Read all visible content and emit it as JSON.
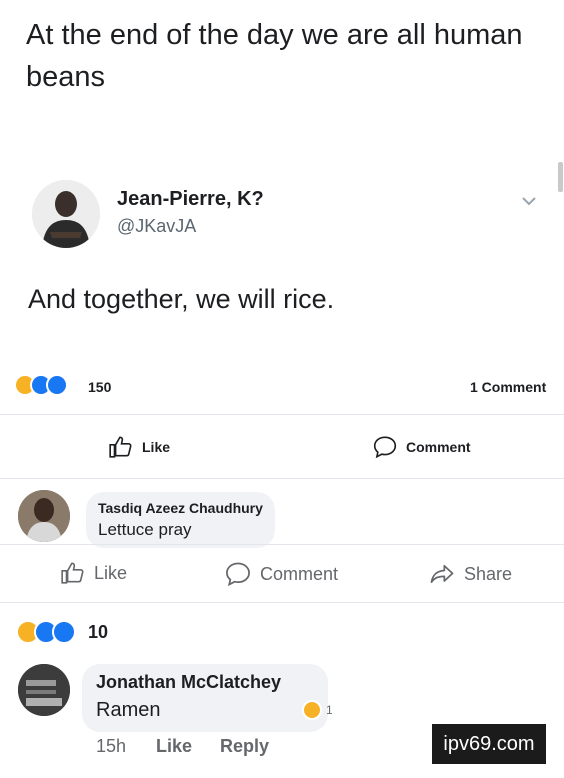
{
  "top_post": {
    "text": "At the end of the day we are all human beans"
  },
  "tweet": {
    "name": "Jean-Pierre, K?",
    "handle": "@JKavJA",
    "body": "And together, we will rice."
  },
  "post_stats": {
    "reaction_icons": [
      "haha-icon",
      "like-icon",
      "love-icon"
    ],
    "reaction_count": "150",
    "comment_count": "1 Comment"
  },
  "post_actions": {
    "like": "Like",
    "comment": "Comment"
  },
  "first_comment": {
    "name": "Tasdiq Azeez Chaudhury",
    "text": "Lettuce pray"
  },
  "second_actions": {
    "like": "Like",
    "comment": "Comment",
    "share": "Share"
  },
  "second_stats": {
    "reaction_icons": [
      "haha-icon",
      "like-icon",
      "love-icon"
    ],
    "reaction_count": "10"
  },
  "reply_comment": {
    "name": "Jonathan McClatchey",
    "text": "Ramen",
    "reaction_count": "1",
    "time": "15h",
    "like": "Like",
    "reply": "Reply"
  },
  "watermark": "ipv69.com",
  "colors": {
    "brand_blue": "#1877f2",
    "haha_yellow": "#f7b125",
    "bubble_gray": "#f0f2f5",
    "muted_text": "#65676b"
  }
}
